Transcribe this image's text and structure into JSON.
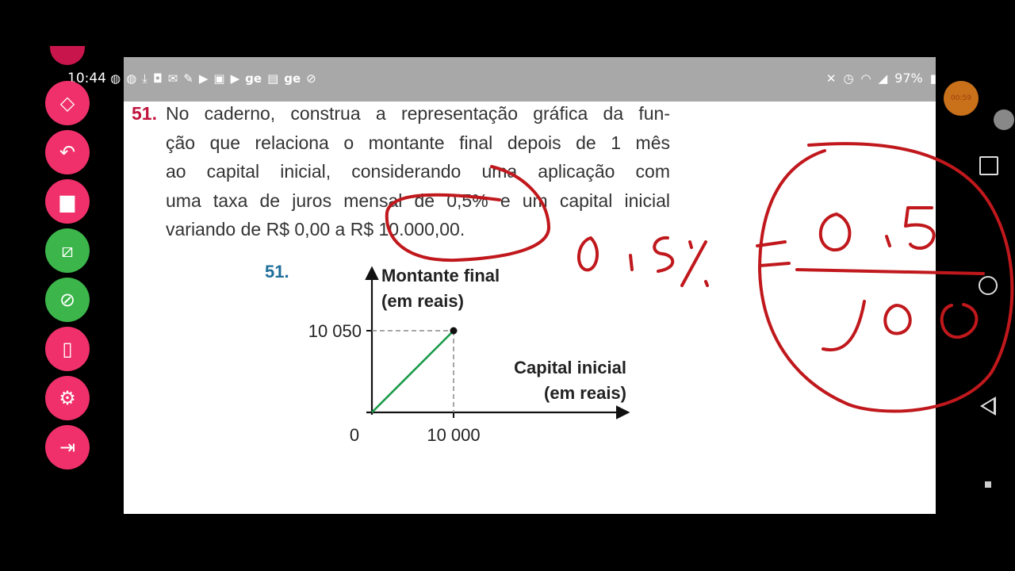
{
  "status_bar": {
    "time": "10:44",
    "left_icons": [
      "messenger-icon",
      "messenger-icon",
      "download-icon",
      "instagram-icon",
      "gmail-icon",
      "pen-icon",
      "video-icon",
      "gallery-icon",
      "youtube-icon",
      "ge-icon",
      "ge-box-icon",
      "ge-icon",
      "no-image-icon"
    ],
    "ge_labels": [
      "ge",
      "ge"
    ],
    "right_icons": [
      "mute-icon",
      "alarm-icon",
      "wifi-icon",
      "signal-icon"
    ],
    "battery": "97%"
  },
  "question": {
    "number": "51.",
    "lines": [
      "No caderno, construa a representação gráfica da fun-",
      "ção que relaciona o montante final depois de 1 mês",
      "ao capital inicial, considerando uma aplicação com",
      "uma taxa de juros mensal de 0,5% e um capital inicial",
      "variando de R$ 0,00 a R$ 10.000,00."
    ]
  },
  "answer": {
    "label": "51.",
    "chart_data": {
      "type": "line",
      "ylabel_line1": "Montante final",
      "ylabel_line2": "(em reais)",
      "xlabel_line1": "Capital inicial",
      "xlabel_line2": "(em reais)",
      "origin_label": "0",
      "x_tick_label": "10 000",
      "y_tick_label": "10 050",
      "points": [
        [
          0,
          0
        ],
        [
          10000,
          10050
        ]
      ],
      "line_color": "#1a9a4a"
    }
  },
  "annotation": {
    "color": "#c0181c",
    "text": "0,5% = 0,5 / 100"
  },
  "toolbar": {
    "buttons": [
      {
        "name": "eraser-icon",
        "color": "red"
      },
      {
        "name": "undo-icon",
        "color": "red"
      },
      {
        "name": "trash-icon",
        "color": "red"
      },
      {
        "name": "hide-layer-icon",
        "color": "green"
      },
      {
        "name": "eye-off-icon",
        "color": "green"
      },
      {
        "name": "vibrate-icon",
        "color": "red"
      },
      {
        "name": "gear-icon",
        "color": "red"
      },
      {
        "name": "exit-icon",
        "color": "red"
      }
    ]
  },
  "nav": {
    "recording_label": "00:59"
  }
}
